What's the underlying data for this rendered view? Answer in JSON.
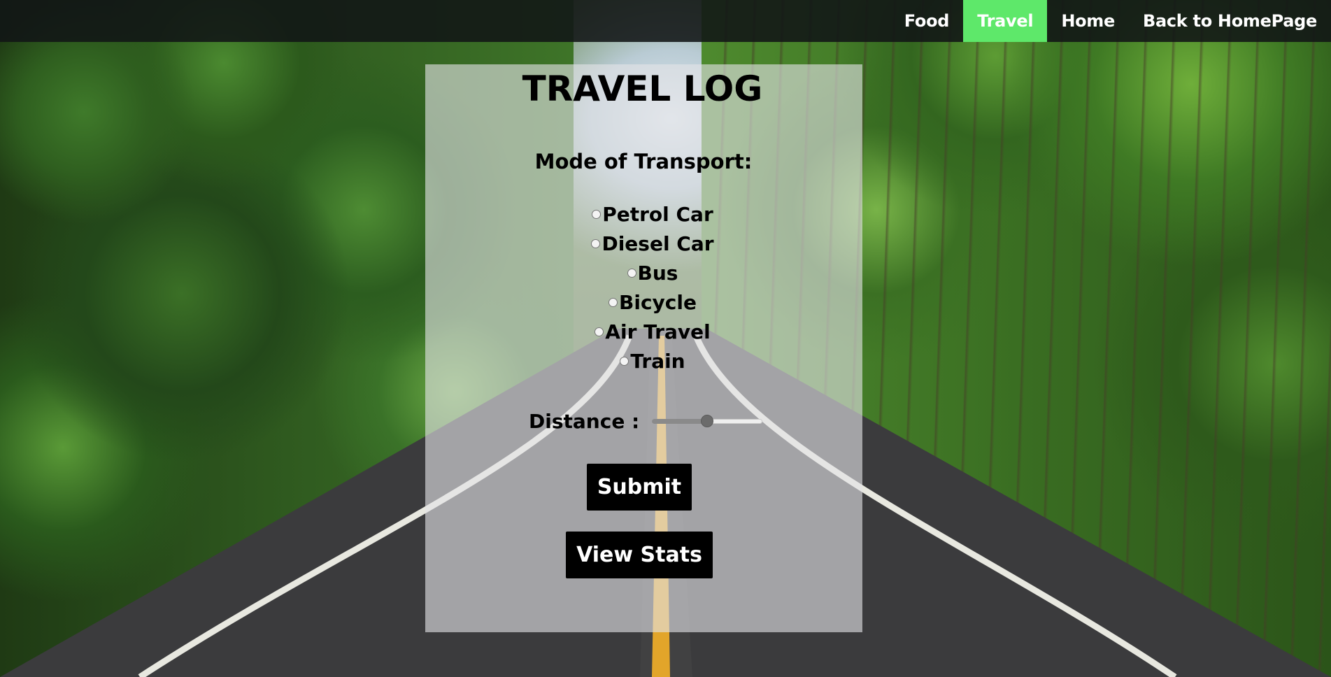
{
  "nav": {
    "items": [
      {
        "label": "Food",
        "active": false
      },
      {
        "label": "Travel",
        "active": true
      },
      {
        "label": "Home",
        "active": false
      },
      {
        "label": "Back to HomePage",
        "active": false
      }
    ],
    "active_color": "#5ee86a"
  },
  "form": {
    "title": "TRAVEL LOG",
    "transport_label": "Mode of Transport:",
    "options": [
      {
        "label": "Petrol Car",
        "checked": false
      },
      {
        "label": "Diesel Car",
        "checked": false
      },
      {
        "label": "Bus",
        "checked": false
      },
      {
        "label": "Bicycle",
        "checked": false
      },
      {
        "label": "Air Travel",
        "checked": false
      },
      {
        "label": "Train",
        "checked": false
      }
    ],
    "distance_label": "Distance :",
    "distance_value_fraction": 0.5,
    "submit_label": "Submit",
    "stats_label": "View Stats"
  }
}
